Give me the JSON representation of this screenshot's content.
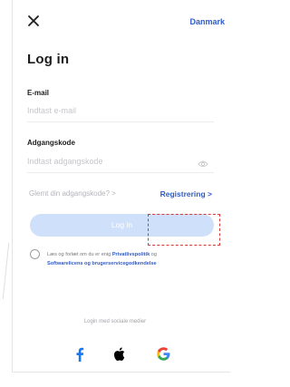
{
  "header": {
    "close_icon": "close-icon",
    "country_label": "Danmark"
  },
  "page": {
    "title": "Log in"
  },
  "form": {
    "email": {
      "label": "E-mail",
      "placeholder": "Indtast e-mail",
      "value": ""
    },
    "password": {
      "label": "Adgangskode",
      "placeholder": "Indtast adgangskode",
      "value": "",
      "toggle_icon": "eye-icon"
    },
    "forgot_password": "Glemt din adgangskode? >",
    "register": "Registrering >",
    "login_button": "Log in"
  },
  "consent": {
    "text_before": "Læs og forlæt om du er enig ",
    "privacy_link": "Privatlivspolitik",
    "text_middle": " og ",
    "license_link": "Softwarelicens og brugerservicegodkendelse"
  },
  "social": {
    "label": "Login med sociale medier",
    "providers": [
      {
        "name": "facebook",
        "icon": "facebook-icon",
        "color": "#1877f2"
      },
      {
        "name": "apple",
        "icon": "apple-icon",
        "color": "#000000"
      },
      {
        "name": "google",
        "icon": "google-icon",
        "color": "#ea4335"
      }
    ]
  },
  "colors": {
    "accent": "#2f5cc4",
    "login_button_disabled": "#cfe0fb",
    "highlight_border": "#d43a3a"
  }
}
